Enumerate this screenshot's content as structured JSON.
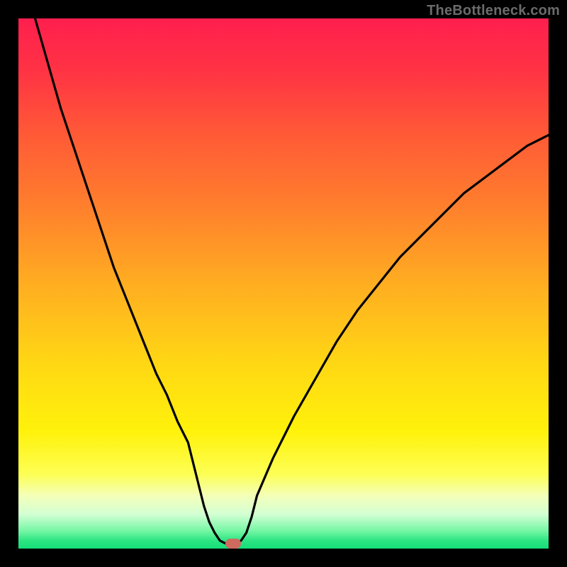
{
  "watermark": {
    "text": "TheBottleneck.com"
  },
  "marker": {
    "color": "#cf6a5e"
  },
  "chart_data": {
    "type": "line",
    "title": "",
    "xlabel": "",
    "ylabel": "",
    "xlim": [
      0,
      100
    ],
    "ylim": [
      0,
      100
    ],
    "grid": false,
    "x": [
      0,
      2,
      4,
      6,
      8,
      10,
      12,
      14,
      16,
      18,
      20,
      22,
      24,
      26,
      28,
      30,
      32,
      33,
      34,
      35,
      36,
      37,
      38,
      39,
      40,
      41,
      42,
      43,
      44,
      45,
      48,
      52,
      56,
      60,
      64,
      68,
      72,
      76,
      80,
      84,
      88,
      92,
      96,
      100
    ],
    "values": [
      null,
      104,
      97,
      90,
      83,
      77,
      71,
      65,
      59,
      53,
      48,
      43,
      38,
      33,
      29,
      24,
      20,
      16,
      12,
      8,
      5,
      3,
      1.5,
      1,
      1,
      1,
      1.5,
      3,
      6,
      10,
      17,
      25,
      32,
      39,
      45,
      50,
      55,
      59,
      63,
      67,
      70,
      73,
      76,
      78
    ],
    "gradient_stops": [
      {
        "pos": 0.0,
        "color": "#ff1f4e"
      },
      {
        "pos": 0.1,
        "color": "#ff3344"
      },
      {
        "pos": 0.22,
        "color": "#ff5a36"
      },
      {
        "pos": 0.35,
        "color": "#ff7e2d"
      },
      {
        "pos": 0.5,
        "color": "#ffad21"
      },
      {
        "pos": 0.65,
        "color": "#ffd714"
      },
      {
        "pos": 0.78,
        "color": "#fff20b"
      },
      {
        "pos": 0.86,
        "color": "#fdff55"
      },
      {
        "pos": 0.9,
        "color": "#f4ffb8"
      },
      {
        "pos": 0.935,
        "color": "#d4ffd4"
      },
      {
        "pos": 0.965,
        "color": "#7bf7a8"
      },
      {
        "pos": 0.985,
        "color": "#2de583"
      },
      {
        "pos": 1.0,
        "color": "#14dd77"
      }
    ],
    "marker_point": {
      "x": 40.5,
      "y": 1
    }
  }
}
